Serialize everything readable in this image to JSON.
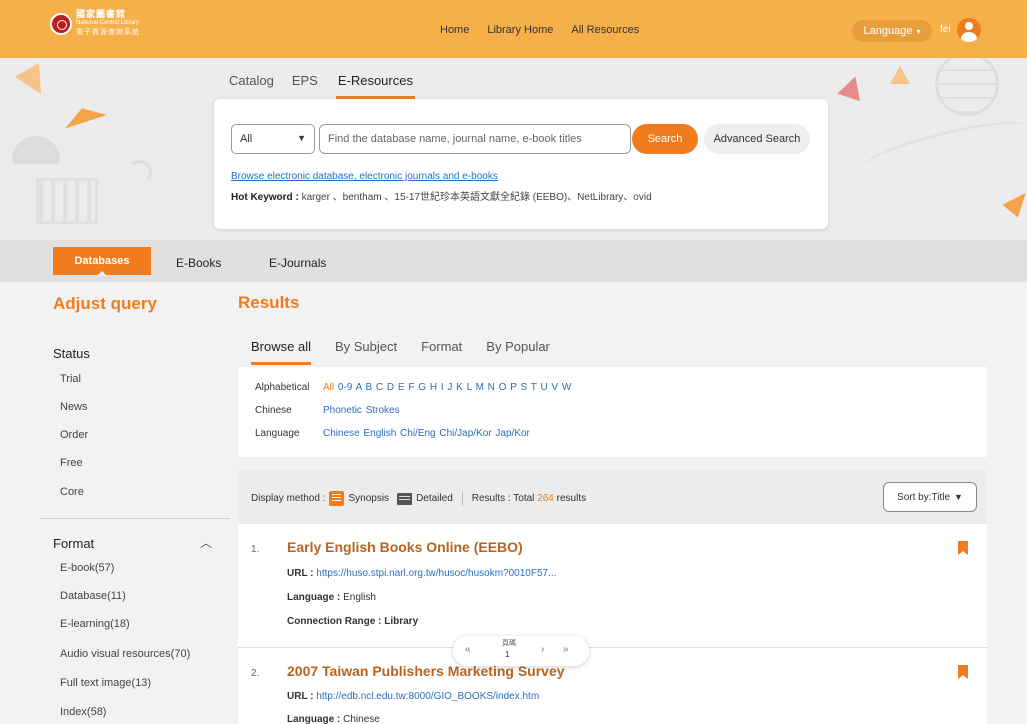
{
  "logo": {
    "line1": "國家圖書館",
    "line2": "National Central Library",
    "line3": "電子資源查詢系統"
  },
  "topnav": [
    "Home",
    "Library Home",
    "All Resources"
  ],
  "language_label": "Language",
  "user_name": "fei",
  "catalog_tabs": [
    "Catalog",
    "EPS",
    "E-Resources"
  ],
  "search": {
    "scope": "All",
    "placeholder": "Find the database name, journal name, e-book titles",
    "button": "Search",
    "advanced": "Advanced Search",
    "browse_link": "Browse electronic database, electronic journals and e-books",
    "hot_label": "Hot Keyword :",
    "hot_keywords": "karger 、bentham 、15-17世紀珍本英語文獻全紀錄 (EEBO)、NetLibrary、ovid"
  },
  "resource_tabs": [
    "Databases",
    "E-Books",
    "E-Journals"
  ],
  "sidebar": {
    "title": "Adjust query",
    "status_heading": "Status",
    "status_items": [
      "Trial",
      "News",
      "Order",
      "Free",
      "Core"
    ],
    "format_heading": "Format",
    "format_items": [
      "E-book(57)",
      "Database(11)",
      "E-learning(18)",
      "Audio visual resources(70)",
      "Full text image(13)",
      "Index(58)"
    ]
  },
  "results": {
    "heading": "Results",
    "subtabs": [
      "Browse all",
      "By Subject",
      "Format",
      "By Popular"
    ],
    "filters": {
      "alpha_label": "Alphabetical",
      "alpha_selected": "All",
      "alpha_rest": "0-9 A B C D E F G H I J K L M N O P S T U V W",
      "chinese_label": "Chinese",
      "chinese_vals": "Phonetic Strokes",
      "language_label": "Language",
      "language_vals": "Chinese English Chi/Eng Chi/Jap/Kor Jap/Kor"
    },
    "display": {
      "label": "Display method :",
      "synopsis": "Synopsis",
      "detailed": "Detailed",
      "results_label": "Results :  Total",
      "total": "264",
      "results_suffix": "results",
      "sort": "Sort by:Title"
    },
    "items": [
      {
        "num": "1.",
        "title": "Early English Books Online (EEBO)",
        "url_label": "URL :",
        "url": "https://huso.stpi.narl.org.tw/husoc/husokm?0010F57...",
        "lang_label": "Language :",
        "lang": "English",
        "conn_label": "Connection Range :",
        "conn": "Library"
      },
      {
        "num": "2.",
        "title": "2007 Taiwan Publishers Marketing Survey",
        "url_label": "URL :",
        "url": "http://edb.ncl.edu.tw:8000/GIO_BOOKS/index.htm",
        "lang_label": "Language :",
        "lang": "Chinese"
      }
    ]
  },
  "pager": {
    "first": "«",
    "label": "頁碼",
    "page": "1",
    "next": "›",
    "last": "»"
  }
}
